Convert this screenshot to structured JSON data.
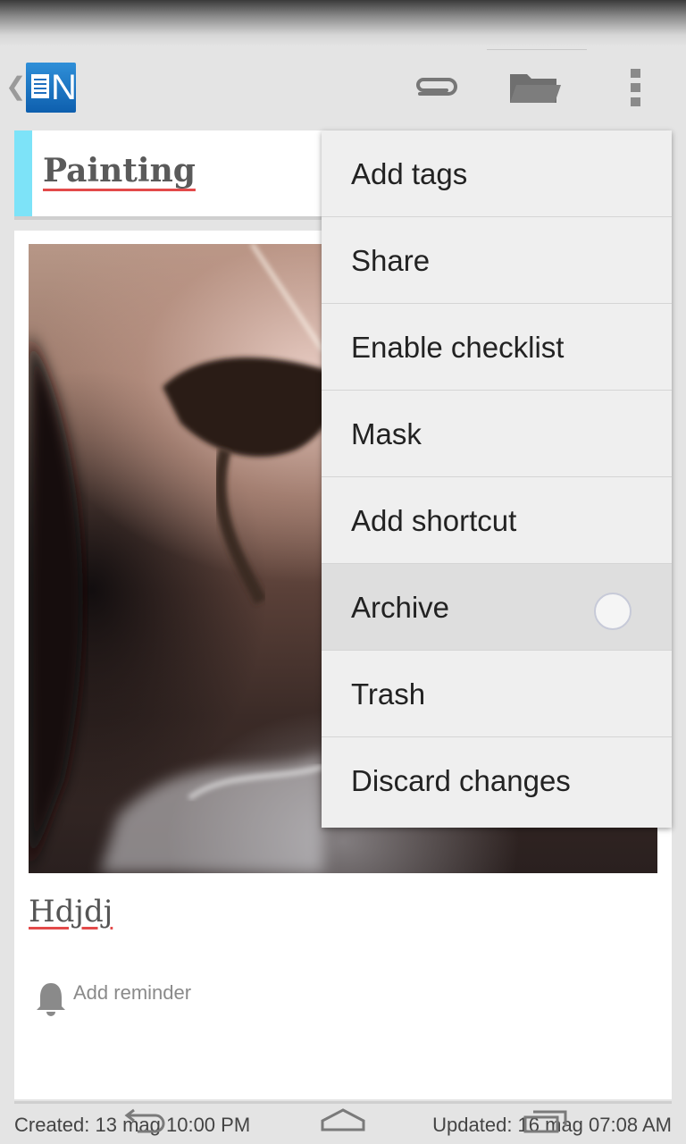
{
  "action_bar": {
    "logo_letter": "N",
    "icons": [
      "chevron-left-icon",
      "app-logo",
      "paperclip-icon",
      "folder-icon",
      "overflow-menu-icon"
    ]
  },
  "note": {
    "title": "Painting",
    "body": "Hdjdj",
    "reminder_label": "Add reminder",
    "created": "Created: 13 mag 10:00 PM",
    "updated": "Updated: 16 mag 07:08 AM"
  },
  "menu": {
    "items": [
      "Add tags",
      "Share",
      "Enable checklist",
      "Mask",
      "Add shortcut",
      "Archive",
      "Trash",
      "Discard changes"
    ],
    "pressed_index": 5
  },
  "colors": {
    "title_accent": "#7de3f8",
    "spellcheck_underline": "#e34a4a",
    "logo_blue": "#1f6fbf"
  }
}
